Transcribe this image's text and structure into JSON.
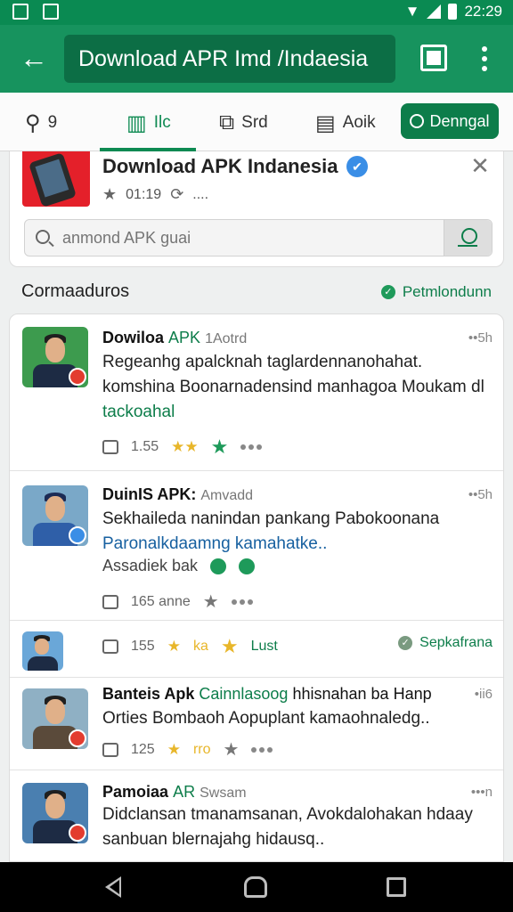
{
  "status_bar": {
    "time": "22:29"
  },
  "app_bar": {
    "title": "Download APR Imd /Indaesia"
  },
  "tabs": [
    {
      "label": "9",
      "icon": "link-icon"
    },
    {
      "label": "Ilc",
      "icon": "grid-icon",
      "active": true
    },
    {
      "label": "Srd",
      "icon": "share-icon"
    },
    {
      "label": "Aoik",
      "icon": "edit-icon"
    }
  ],
  "download_button": {
    "label": "Denngal"
  },
  "app_card": {
    "name": "Download APK Indanesia",
    "rating": "01:19",
    "comments": "....",
    "search_placeholder": "anmond APK guai"
  },
  "section": {
    "title": "Cormaaduros",
    "link": "Petmlondunn"
  },
  "posts": [
    {
      "author": "Dowiloa",
      "tag": "APK",
      "sub": "1Aotrd",
      "time": "••5h",
      "text_1": "Regeanhg apalcknah taglardennanohahat. komshina Boonarnadensind manhagoa Moukam dl",
      "text_hl": "tackoahal",
      "likes": "1.55"
    },
    {
      "author": "DuinIS APK:",
      "sub": "Amvadd",
      "time": "••5h",
      "text_1": "Sekhaileda nanindan pankang Pabokoonana",
      "text_hl": "Paronalkdaamng kamahatke..",
      "text_2": "Assadiek bak",
      "likes": "165 anne"
    },
    {
      "likes": "155",
      "ka": "ka",
      "hast": "Lust",
      "link": "Sepkafrana"
    },
    {
      "author": "Banteis Apk",
      "tag": "Cainnlasoog",
      "sub": "hhisnahan ba Hanp",
      "time": "•ii6",
      "text_1": "Orties Bombaoh Aopuplant kamaohnaledg..",
      "likes": "125",
      "ka": "rro"
    },
    {
      "author": "Pamoiaa",
      "tag": "AR",
      "sub": "Swsam",
      "time": "•••n",
      "text_1": "Didclansan tmanamsanan, Avokdalohakan hdaay",
      "text_hl": "sanbuan blernajahg hidausq.."
    }
  ],
  "colors": {
    "primary": "#17935e",
    "accent": "#0d7d4a",
    "link": "#1760a0"
  }
}
